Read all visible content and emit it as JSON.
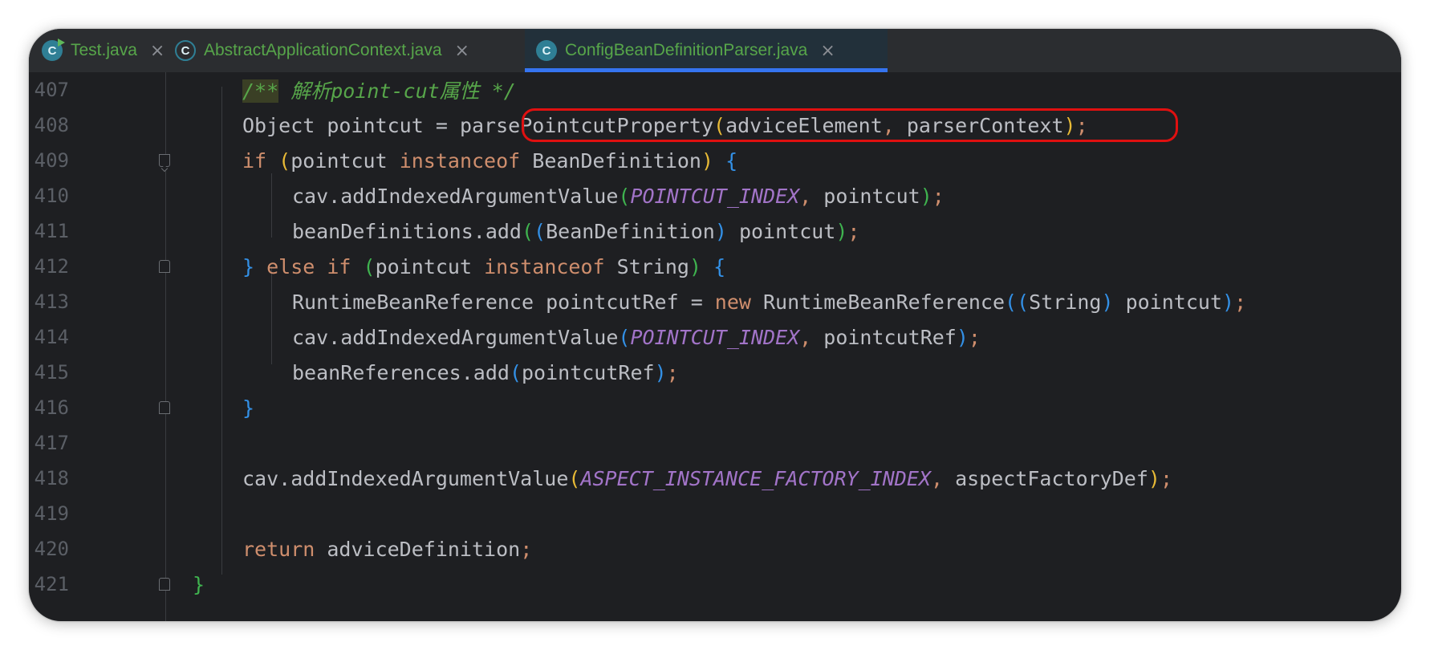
{
  "tabs": [
    {
      "label": "Test.java",
      "icon": "java-run-class-icon",
      "icon_glyph": "C",
      "active": false
    },
    {
      "label": "AbstractApplicationContext.java",
      "icon": "java-abstract-class-icon",
      "icon_glyph": "C",
      "active": false
    },
    {
      "label": "ConfigBeanDefinitionParser.java",
      "icon": "java-class-icon",
      "icon_glyph": "C",
      "active": true
    }
  ],
  "colors": {
    "editor_bg": "#1e1f22",
    "tab_text": "#57a64a",
    "active_tab_underline": "#3574f0",
    "highlight_border": "#e01010"
  },
  "lines": [
    {
      "number": "407",
      "tokens": [
        "/**",
        " 解析point-cut属性 */"
      ]
    },
    {
      "number": "408",
      "tokens": [
        "Object pointcut = ",
        "parsePointcutProperty",
        "(",
        "adviceElement",
        ", ",
        "parserContext",
        ")",
        ";"
      ]
    },
    {
      "number": "409",
      "tokens": [
        "if",
        " ",
        "(",
        "pointcut ",
        "instanceof",
        " BeanDefinition",
        ")",
        " ",
        "{"
      ]
    },
    {
      "number": "410",
      "tokens": [
        "cav.addIndexedArgumentValue",
        "(",
        "POINTCUT_INDEX",
        ", ",
        "pointcut",
        ")",
        ";"
      ]
    },
    {
      "number": "411",
      "tokens": [
        "beanDefinitions.add",
        "(",
        "(",
        "BeanDefinition",
        ")",
        " pointcut",
        ")",
        ";"
      ]
    },
    {
      "number": "412",
      "tokens": [
        "}",
        " ",
        "else if",
        " ",
        "(",
        "pointcut ",
        "instanceof",
        " String",
        ")",
        " ",
        "{"
      ]
    },
    {
      "number": "413",
      "tokens": [
        "RuntimeBeanReference pointcutRef = ",
        "new",
        " RuntimeBeanReference",
        "(",
        "(",
        "String",
        ")",
        " pointcut",
        ")",
        ";"
      ]
    },
    {
      "number": "414",
      "tokens": [
        "cav.addIndexedArgumentValue",
        "(",
        "POINTCUT_INDEX",
        ", ",
        "pointcutRef",
        ")",
        ";"
      ]
    },
    {
      "number": "415",
      "tokens": [
        "beanReferences.add",
        "(",
        "pointcutRef",
        ")",
        ";"
      ]
    },
    {
      "number": "416",
      "tokens": [
        "}"
      ]
    },
    {
      "number": "417",
      "tokens": []
    },
    {
      "number": "418",
      "tokens": [
        "cav.addIndexedArgumentValue",
        "(",
        "ASPECT_INSTANCE_FACTORY_INDEX",
        ", ",
        "aspectFactoryDef",
        ")",
        ";"
      ]
    },
    {
      "number": "419",
      "tokens": []
    },
    {
      "number": "420",
      "tokens": [
        "return",
        " adviceDefinition",
        ";"
      ]
    },
    {
      "number": "421",
      "tokens": [
        "}"
      ]
    }
  ]
}
